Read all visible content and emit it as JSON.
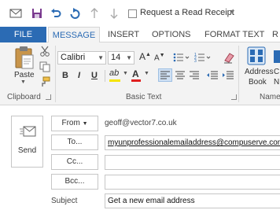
{
  "quick_access": {
    "read_receipt_label": "Request a Read Receipt",
    "icons": [
      "envelope-icon",
      "save-icon",
      "undo-icon",
      "redo-icon",
      "up-arrow-icon",
      "down-arrow-icon",
      "customize-dropdown-icon"
    ]
  },
  "tabs": [
    {
      "label": "FILE",
      "active": false
    },
    {
      "label": "MESSAGE",
      "active": true
    },
    {
      "label": "INSERT",
      "active": false
    },
    {
      "label": "OPTIONS",
      "active": false
    },
    {
      "label": "FORMAT TEXT",
      "active": false
    },
    {
      "label": "R",
      "active": false
    }
  ],
  "ribbon": {
    "clipboard": {
      "paste_label": "Paste",
      "group_label": "Clipboard"
    },
    "basic_text": {
      "font_name": "Calibri",
      "font_size": "14",
      "bold": "B",
      "italic": "I",
      "underline": "U",
      "group_label": "Basic Text"
    },
    "names": {
      "address_book_line1": "Address",
      "address_book_line2": "Book",
      "check_names_cut1": "C",
      "check_names_cut2": "N",
      "group_label": "Names"
    }
  },
  "message": {
    "send_label": "Send",
    "from_label": "From",
    "from_value": "geoff@vector7.co.uk",
    "to_label": "To...",
    "to_value": "myunprofessionalemailaddress@compuserve.com",
    "cc_label": "Cc...",
    "cc_value": "",
    "bcc_label": "Bcc...",
    "bcc_value": "",
    "subject_label": "Subject",
    "subject_value": "Get a new email address"
  },
  "colors": {
    "file_tab": "#2b6bb4",
    "active_tab_text": "#2b6bb4",
    "ribbon_bg": "#f3f3f3",
    "highlight_yellow": "#f5e400",
    "font_red": "#e02020"
  }
}
